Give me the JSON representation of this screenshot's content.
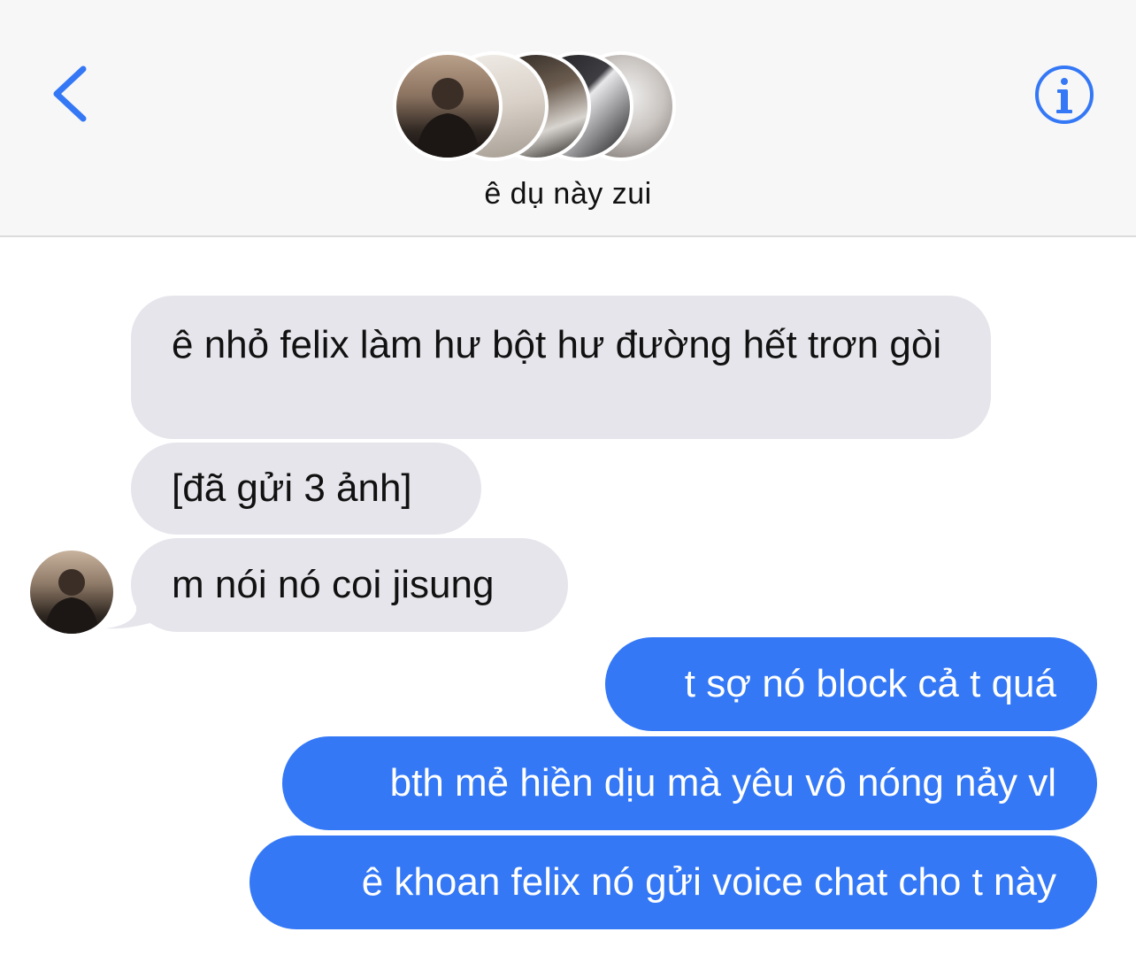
{
  "header": {
    "group_name": "ê dụ này zui",
    "back_icon": "chevron-left-icon",
    "info_icon": "info-circle-icon",
    "accent_color": "#3478f6"
  },
  "messages": [
    {
      "direction": "incoming",
      "text": "ê nhỏ felix làm hư bột hư đường hết trơn gòi"
    },
    {
      "direction": "incoming",
      "text": "[đã gửi 3 ảnh]"
    },
    {
      "direction": "incoming",
      "text": "m nói nó coi jisung"
    },
    {
      "direction": "outgoing",
      "text": "t sợ nó block cả t quá"
    },
    {
      "direction": "outgoing",
      "text": "bth mẻ hiền dịu mà yêu vô nóng nảy vl"
    },
    {
      "direction": "outgoing",
      "text": "ê khoan felix nó gửi voice chat cho t này"
    }
  ],
  "colors": {
    "incoming_bubble": "#e6e5eb",
    "outgoing_bubble": "#3478f6",
    "header_background": "#f7f7f7"
  }
}
